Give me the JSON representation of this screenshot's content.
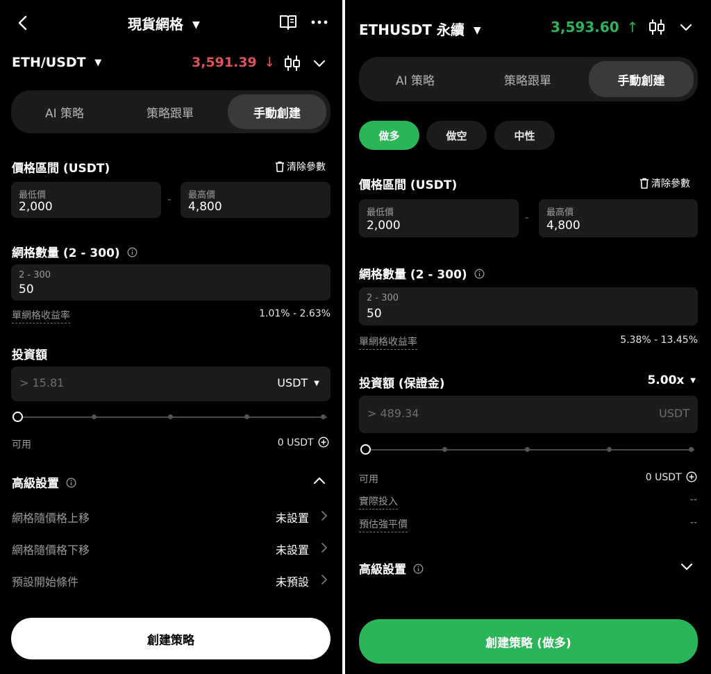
{
  "colors": {
    "green": "#2eb35a",
    "red": "#e0525b",
    "accent_button_green": "#2bb559"
  },
  "left": {
    "header": {
      "title": "現貨網格",
      "back_icon": "back-icon",
      "book_icon": "book-icon",
      "more_icon": "more-icon"
    },
    "pair": {
      "symbol": "ETH/USDT",
      "price": "3,591.39",
      "direction": "↓"
    },
    "tabs": [
      {
        "label": "AI 策略"
      },
      {
        "label": "策略跟單"
      },
      {
        "label": "手動創建",
        "active": true
      }
    ],
    "price_range": {
      "title": "價格區間 (USDT)",
      "clear_label": "清除參數",
      "min": {
        "label": "最低價",
        "value": "2,000"
      },
      "sep": "-",
      "max": {
        "label": "最高價",
        "value": "4,800"
      }
    },
    "grid_count": {
      "title": "網格數量 (2 - 300)",
      "placeholder": "2 - 300",
      "value": "50"
    },
    "profit": {
      "label": "單網格收益率",
      "value": "1.01% - 2.63%"
    },
    "investment": {
      "title": "投資額",
      "placeholder": "> 15.81",
      "currency": "USDT",
      "slider_level": 0
    },
    "available": {
      "label": "可用",
      "value": "0 USDT"
    },
    "advanced": {
      "title": "高級設置",
      "rows": [
        {
          "label": "網格隨價格上移",
          "value": "未設置"
        },
        {
          "label": "網格隨價格下移",
          "value": "未設置"
        },
        {
          "label": "預設開始條件",
          "value": "未預設"
        }
      ]
    },
    "submit": "創建策略"
  },
  "right": {
    "header": {
      "symbol": "ETHUSDT 永續",
      "price": "3,593.60",
      "direction": "↑"
    },
    "tabs": [
      {
        "label": "AI 策略"
      },
      {
        "label": "策略跟單"
      },
      {
        "label": "手動創建",
        "active": true
      }
    ],
    "modes": [
      {
        "label": "做多",
        "active": true
      },
      {
        "label": "做空"
      },
      {
        "label": "中性"
      }
    ],
    "price_range": {
      "title": "價格區間 (USDT)",
      "clear_label": "清除參數",
      "min": {
        "label": "最低價",
        "value": "2,000"
      },
      "sep": "-",
      "max": {
        "label": "最高價",
        "value": "4,800"
      }
    },
    "grid_count": {
      "title": "網格數量 (2 - 300)",
      "placeholder": "2 - 300",
      "value": "50"
    },
    "profit": {
      "label": "單網格收益率",
      "value": "5.38% - 13.45%"
    },
    "investment": {
      "title": "投資額 (保證金)",
      "leverage": "5.00x",
      "placeholder": "> 489.34",
      "currency": "USDT",
      "slider_level": 0
    },
    "available": {
      "label": "可用",
      "value": "0 USDT"
    },
    "actual": {
      "label": "實際投入",
      "value": "--"
    },
    "liq": {
      "label": "預估強平價",
      "value": "--"
    },
    "advanced": {
      "title": "高級設置"
    },
    "submit": "創建策略 (做多)"
  }
}
